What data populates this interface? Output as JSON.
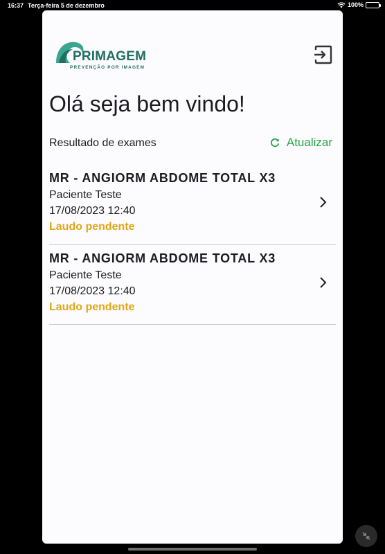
{
  "status_bar": {
    "time": "16:37",
    "date": "Terça-feira 5 de dezembro",
    "battery": "100%",
    "icons": [
      "wifi-icon",
      "battery-icon"
    ]
  },
  "header": {
    "logo_name": "PRIMAGEM",
    "logo_tagline": "PREVENÇÃO POR IMAGEM",
    "logout_icon": "logout-icon"
  },
  "greeting": "Olá seja bem vindo!",
  "section": {
    "title": "Resultado de exames",
    "refresh_label": "Atualizar",
    "refresh_icon": "refresh-icon"
  },
  "exams": [
    {
      "title": "MR - ANGIORM ABDOME TOTAL X3",
      "patient": "Paciente Teste",
      "datetime": "17/08/2023 12:40",
      "status": "Laudo pendente"
    },
    {
      "title": "MR - ANGIORM ABDOME TOTAL X3",
      "patient": "Paciente Teste",
      "datetime": "17/08/2023 12:40",
      "status": "Laudo pendente"
    }
  ],
  "colors": {
    "brand": "#1f6e62",
    "accent_green": "#26a546",
    "pending": "#e2a614",
    "background": "#fcfbfe"
  }
}
